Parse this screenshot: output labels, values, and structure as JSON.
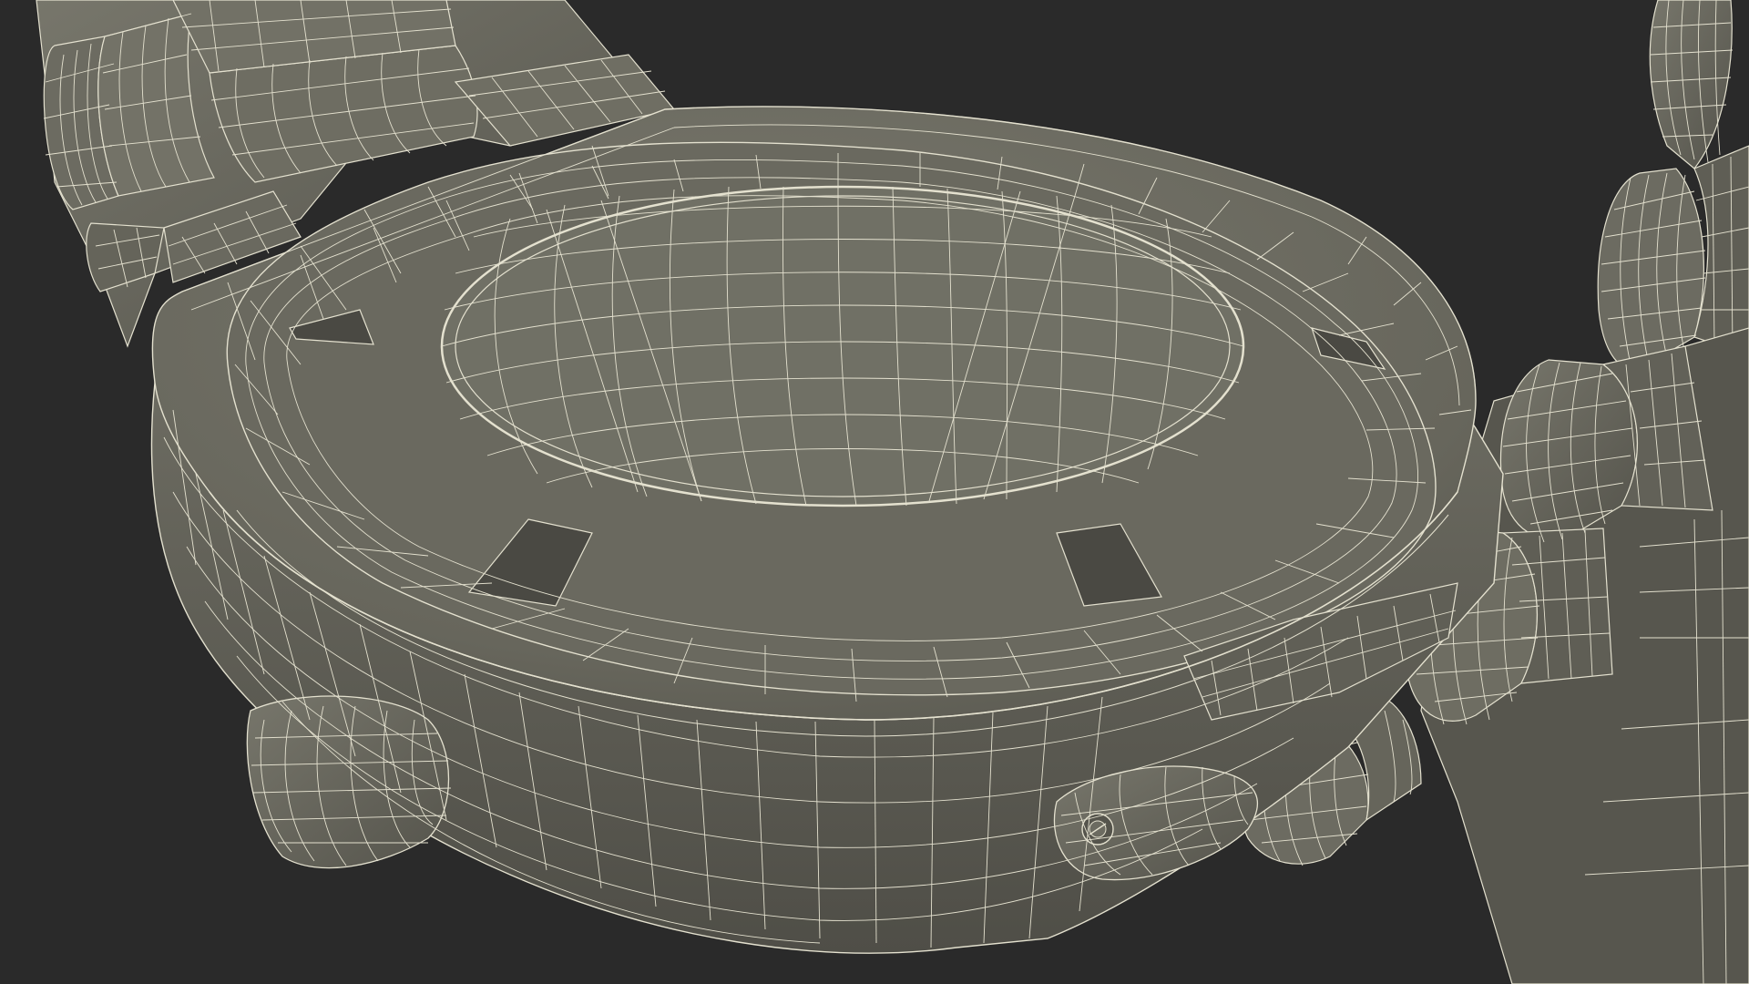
{
  "scene": {
    "subject": "wireframe-watch-caseback-render",
    "background_color": "#2a2a2a",
    "mesh_fill_color": "#6e6d63",
    "mesh_shadow_color": "#4d4c45",
    "mesh_highlight_color": "#7d7c71",
    "wire_color": "#e4e1cf"
  }
}
